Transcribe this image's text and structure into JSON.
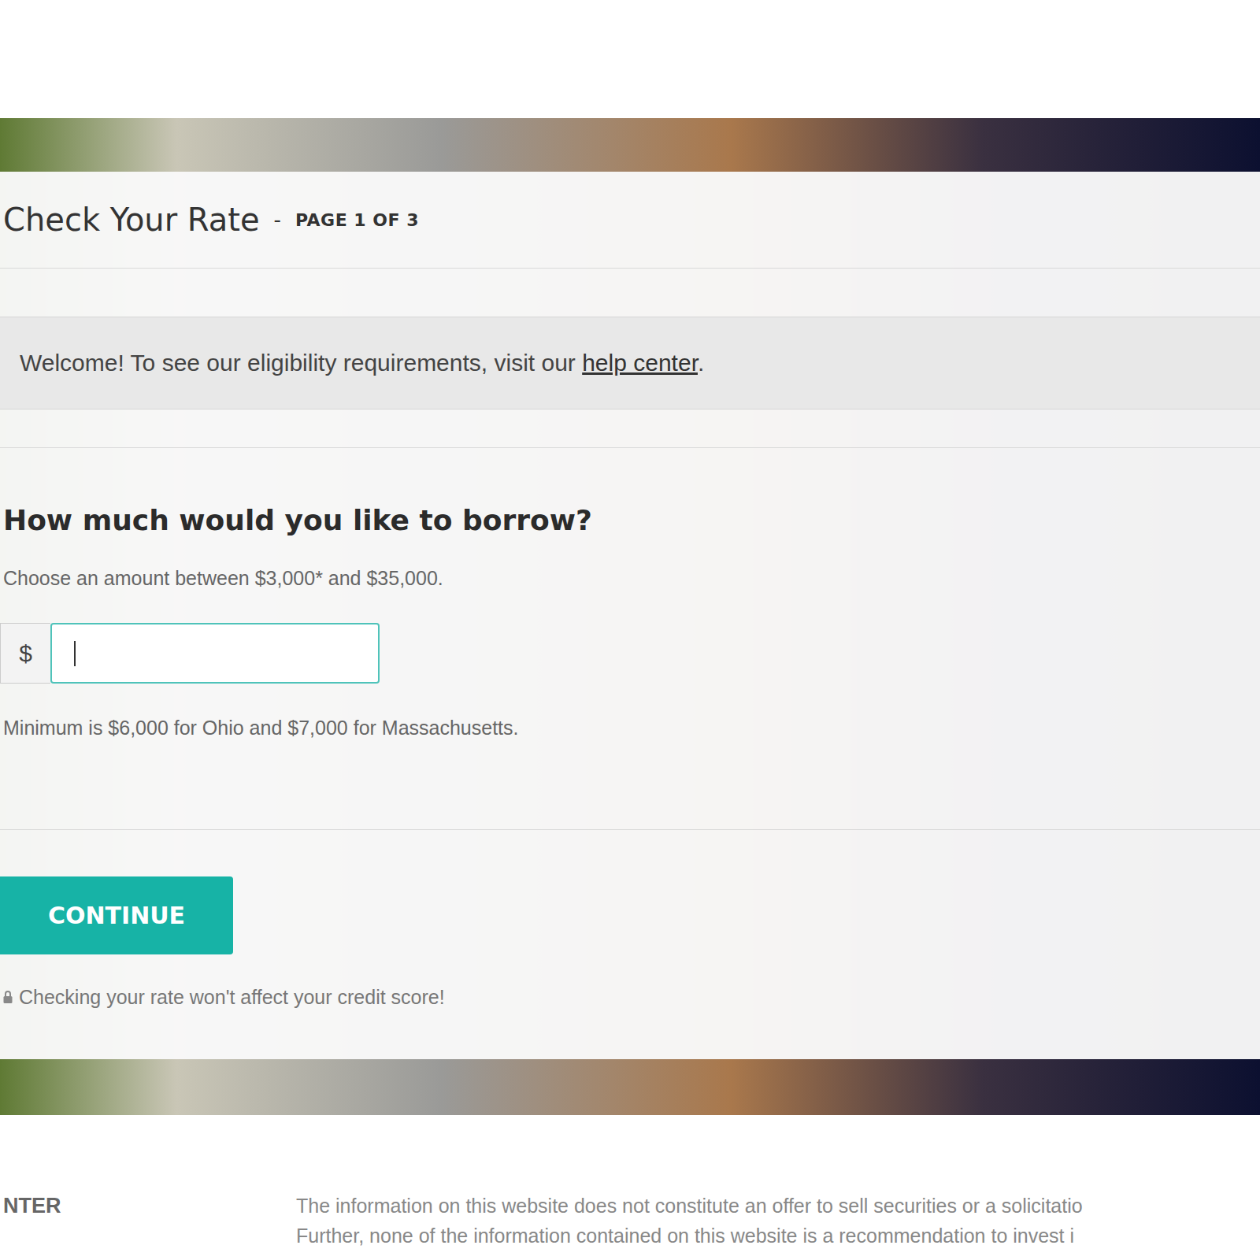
{
  "header": {
    "title": "Check Your Rate",
    "separator": "-",
    "page": "PAGE 1 OF 3"
  },
  "banner": {
    "text": "Welcome! To see our eligibility requirements, visit our ",
    "link": "help center",
    "end": "."
  },
  "question": {
    "title": "How much would you like to borrow?",
    "hint": "Choose an amount between $3,000* and $35,000.",
    "currency": "$",
    "value": "",
    "focused": true,
    "note": "Minimum is $6,000 for Ohio and $7,000 for Massachusetts."
  },
  "button": "CONTINUE",
  "credit_note": "Checking your rate won't affect your credit score!",
  "footer": {
    "heading": "NTER",
    "lines": [
      "The information on this website does not constitute an offer to sell securities or a solicitatio",
      "Further, none of the information contained on this website is a recommendation to invest i"
    ]
  }
}
